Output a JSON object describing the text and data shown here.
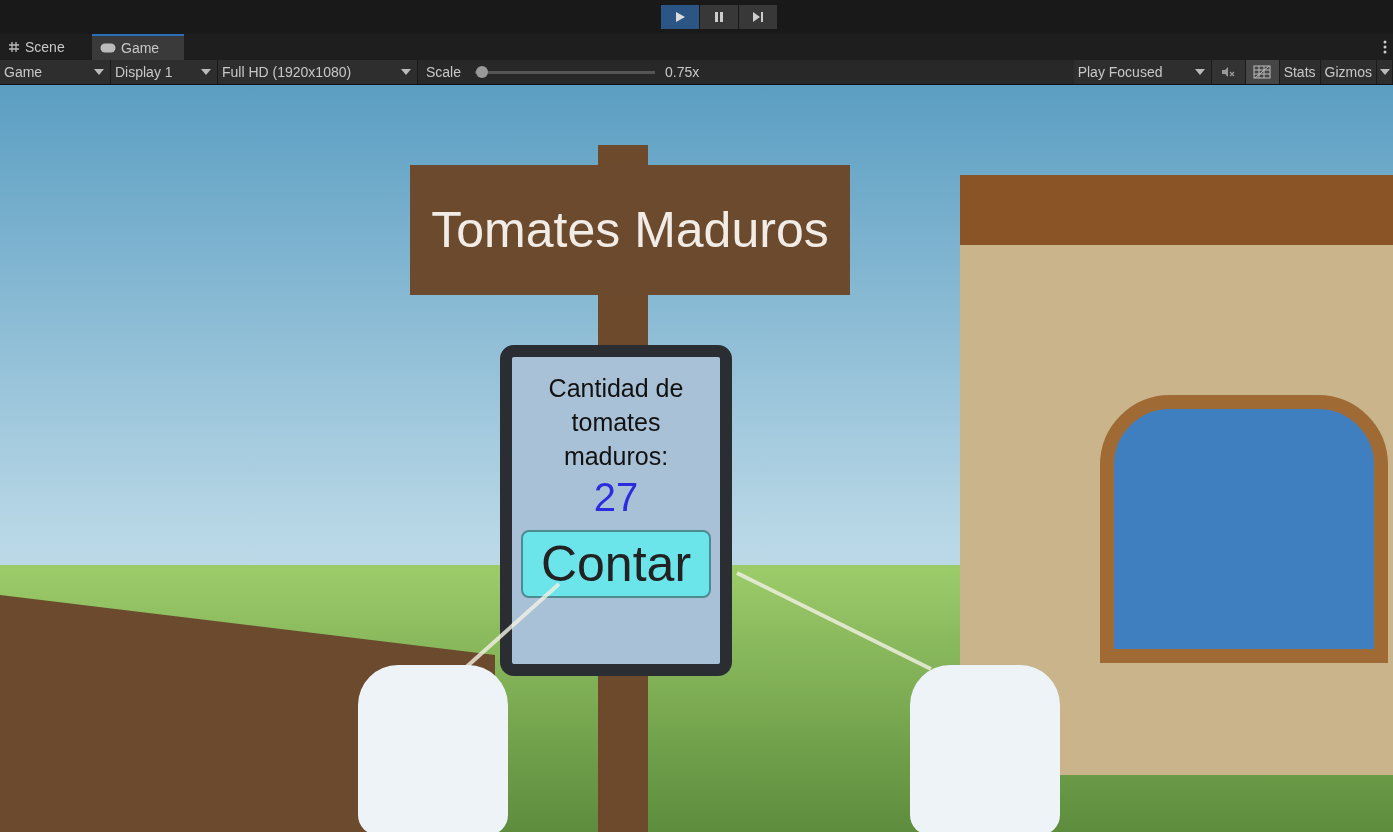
{
  "toolbar": {
    "play_buttons": [
      {
        "kind": "play",
        "selected": true
      },
      {
        "kind": "pause",
        "selected": false
      },
      {
        "kind": "step",
        "selected": false
      }
    ]
  },
  "tabs": [
    {
      "label": "Scene",
      "kind": "scene",
      "selected": false
    },
    {
      "label": "Game",
      "kind": "game",
      "selected": true
    }
  ],
  "game_toolbar": {
    "view_mode": "Game",
    "display": "Display 1",
    "resolution": "Full HD (1920x1080)",
    "scale_label": "Scale",
    "scale": {
      "level": 0.04,
      "reading": "0.75x"
    },
    "play_mode": "Play Focused",
    "stats": "Stats",
    "gizmos": "Gizmos"
  },
  "scene": {
    "sign": "Tomates Maduros",
    "panel": {
      "label": "Cantidad de tomates maduros:",
      "count": "27",
      "button": "Contar"
    }
  }
}
